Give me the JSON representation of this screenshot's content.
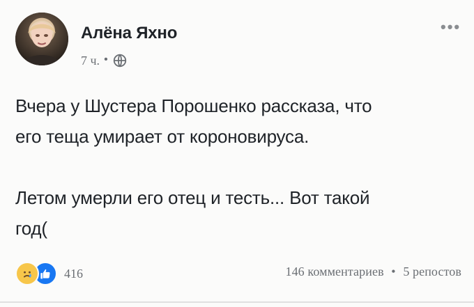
{
  "post": {
    "author": "Алёна Яхно",
    "time": "7 ч.",
    "separator_dot": "•",
    "more_icon": "more-horizontal-icon",
    "privacy_icon": "globe-icon",
    "content": {
      "paragraph1_line1": "Вчера у Шустера Порошенко рассказа, что",
      "paragraph1_line2": "его теща умирает от короновируса.",
      "paragraph2_line1": "Летом умерли его отец и тесть... Вот такой",
      "paragraph2_line2": "год("
    },
    "reactions": {
      "count": "416",
      "icons": [
        "sad-reaction-icon",
        "like-reaction-icon"
      ],
      "colors": {
        "sad": "#f7c64a",
        "like": "#1877f2"
      }
    },
    "stats": {
      "comments": "146 комментариев",
      "dot": "•",
      "shares": "5 репостов"
    }
  }
}
